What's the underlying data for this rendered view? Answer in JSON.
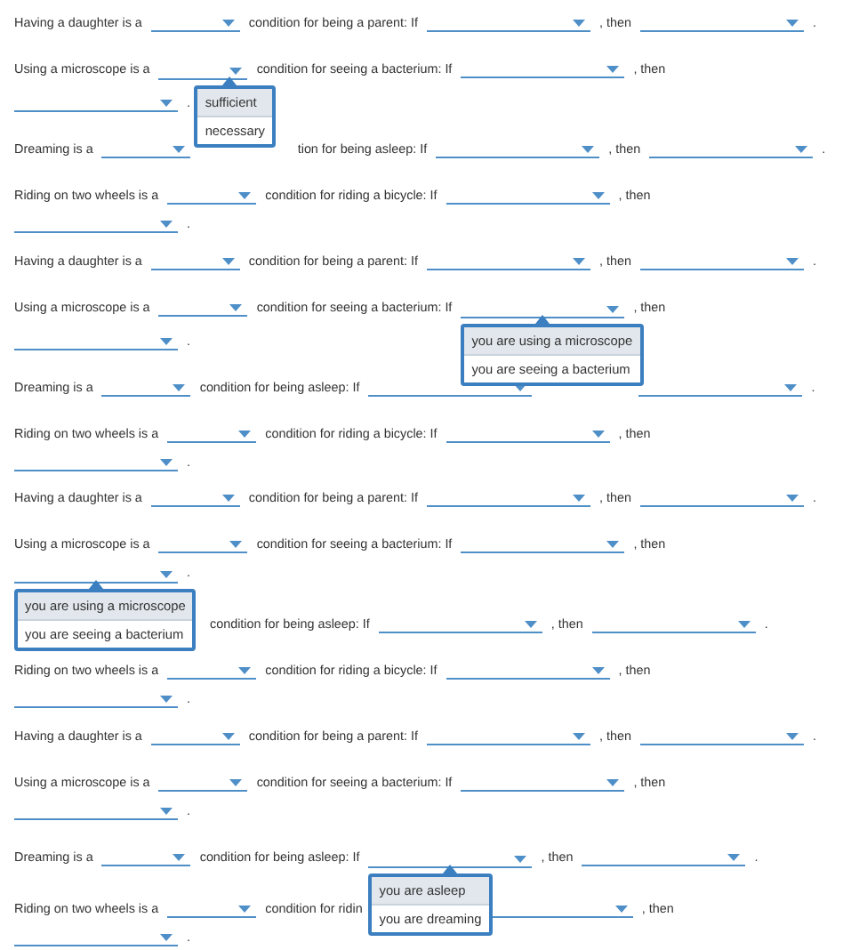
{
  "panels": [
    {
      "questions": [
        {
          "segments": [
            {
              "kind": "text",
              "text": "Having a daughter is a"
            },
            {
              "kind": "choice"
            },
            {
              "kind": "text",
              "text": "condition for being a parent: If"
            },
            {
              "kind": "clause"
            },
            {
              "kind": "text",
              "text": ", then"
            },
            {
              "kind": "clause"
            },
            {
              "kind": "text",
              "text": "."
            }
          ]
        },
        {
          "segments": [
            {
              "kind": "text",
              "text": "Using a microscope is a"
            },
            {
              "kind": "choice",
              "menu": [
                {
                  "label": "sufficient",
                  "selected": true
                },
                {
                  "label": "necessary",
                  "selected": false
                }
              ]
            },
            {
              "kind": "text",
              "text": "condition for seeing a bacterium: If"
            },
            {
              "kind": "clause"
            },
            {
              "kind": "text",
              "text": ", then"
            },
            {
              "kind": "clause"
            },
            {
              "kind": "text",
              "text": "."
            }
          ]
        },
        {
          "segments": [
            {
              "kind": "text",
              "text": "Dreaming is a"
            },
            {
              "kind": "choice"
            },
            {
              "kind": "hidden"
            },
            {
              "kind": "text",
              "text": "tion for being asleep: If"
            },
            {
              "kind": "clause"
            },
            {
              "kind": "text",
              "text": ", then"
            },
            {
              "kind": "clause"
            },
            {
              "kind": "text",
              "text": "."
            }
          ]
        },
        {
          "segments": [
            {
              "kind": "text",
              "text": "Riding on two wheels is a"
            },
            {
              "kind": "choice"
            },
            {
              "kind": "text",
              "text": "condition for riding a bicycle: If"
            },
            {
              "kind": "clause"
            },
            {
              "kind": "text",
              "text": ", then"
            },
            {
              "kind": "clause"
            },
            {
              "kind": "text",
              "text": "."
            }
          ]
        }
      ]
    },
    {
      "questions": [
        {
          "segments": [
            {
              "kind": "text",
              "text": "Having a daughter is a"
            },
            {
              "kind": "choice"
            },
            {
              "kind": "text",
              "text": "condition for being a parent: If"
            },
            {
              "kind": "clause"
            },
            {
              "kind": "text",
              "text": ", then"
            },
            {
              "kind": "clause"
            },
            {
              "kind": "text",
              "text": "."
            }
          ]
        },
        {
          "segments": [
            {
              "kind": "text",
              "text": "Using a microscope is a"
            },
            {
              "kind": "choice"
            },
            {
              "kind": "text",
              "text": "condition for seeing a bacterium: If"
            },
            {
              "kind": "clause",
              "menu": [
                {
                  "label": "you are using a microscope",
                  "selected": true
                },
                {
                  "label": "you are seeing a bacterium",
                  "selected": false
                }
              ]
            },
            {
              "kind": "text",
              "text": ", then"
            },
            {
              "kind": "clause"
            },
            {
              "kind": "text",
              "text": "."
            }
          ]
        },
        {
          "segments": [
            {
              "kind": "text",
              "text": "Dreaming is a"
            },
            {
              "kind": "choice"
            },
            {
              "kind": "text",
              "text": "condition for being asleep: If"
            },
            {
              "kind": "clause"
            },
            {
              "kind": "hidden"
            },
            {
              "kind": "clause"
            },
            {
              "kind": "text",
              "text": "."
            }
          ]
        },
        {
          "segments": [
            {
              "kind": "text",
              "text": "Riding on two wheels is a"
            },
            {
              "kind": "choice"
            },
            {
              "kind": "text",
              "text": "condition for riding a bicycle: If"
            },
            {
              "kind": "clause"
            },
            {
              "kind": "text",
              "text": ", then"
            },
            {
              "kind": "clause"
            },
            {
              "kind": "text",
              "text": "."
            }
          ]
        }
      ]
    },
    {
      "questions": [
        {
          "segments": [
            {
              "kind": "text",
              "text": "Having a daughter is a"
            },
            {
              "kind": "choice"
            },
            {
              "kind": "text",
              "text": "condition for being a parent: If"
            },
            {
              "kind": "clause"
            },
            {
              "kind": "text",
              "text": ", then"
            },
            {
              "kind": "clause"
            },
            {
              "kind": "text",
              "text": "."
            }
          ]
        },
        {
          "segments": [
            {
              "kind": "text",
              "text": "Using a microscope is a"
            },
            {
              "kind": "choice"
            },
            {
              "kind": "text",
              "text": "condition for seeing a bacterium: If"
            },
            {
              "kind": "clause"
            },
            {
              "kind": "text",
              "text": ", then"
            },
            {
              "kind": "clause",
              "menu": [
                {
                  "label": "you are using a microscope",
                  "selected": true
                },
                {
                  "label": "you are seeing a bacterium",
                  "selected": false
                }
              ]
            },
            {
              "kind": "text",
              "text": "."
            }
          ]
        },
        {
          "segments": [
            {
              "kind": "hidden"
            },
            {
              "kind": "hidden"
            },
            {
              "kind": "text",
              "text": "condition for being asleep: If"
            },
            {
              "kind": "clause"
            },
            {
              "kind": "text",
              "text": ", then"
            },
            {
              "kind": "clause"
            },
            {
              "kind": "text",
              "text": "."
            }
          ]
        },
        {
          "segments": [
            {
              "kind": "text",
              "text": "Riding on two wheels is a"
            },
            {
              "kind": "choice"
            },
            {
              "kind": "text",
              "text": "condition for riding a bicycle: If"
            },
            {
              "kind": "clause"
            },
            {
              "kind": "text",
              "text": ", then"
            },
            {
              "kind": "clause"
            },
            {
              "kind": "text",
              "text": "."
            }
          ]
        }
      ]
    },
    {
      "questions": [
        {
          "segments": [
            {
              "kind": "text",
              "text": "Having a daughter is a"
            },
            {
              "kind": "choice"
            },
            {
              "kind": "text",
              "text": "condition for being a parent: If"
            },
            {
              "kind": "clause"
            },
            {
              "kind": "text",
              "text": ", then"
            },
            {
              "kind": "clause"
            },
            {
              "kind": "text",
              "text": "."
            }
          ]
        },
        {
          "segments": [
            {
              "kind": "text",
              "text": "Using a microscope is a"
            },
            {
              "kind": "choice"
            },
            {
              "kind": "text",
              "text": "condition for seeing a bacterium: If"
            },
            {
              "kind": "clause"
            },
            {
              "kind": "text",
              "text": ", then"
            },
            {
              "kind": "clause"
            },
            {
              "kind": "text",
              "text": "."
            }
          ]
        },
        {
          "segments": [
            {
              "kind": "text",
              "text": "Dreaming is a"
            },
            {
              "kind": "choice"
            },
            {
              "kind": "text",
              "text": "condition for being asleep: If"
            },
            {
              "kind": "clause",
              "menu": [
                {
                  "label": "you are asleep",
                  "selected": true
                },
                {
                  "label": "you are dreaming",
                  "selected": false
                }
              ]
            },
            {
              "kind": "text",
              "text": ", then"
            },
            {
              "kind": "clause"
            },
            {
              "kind": "text",
              "text": "."
            }
          ]
        },
        {
          "segments": [
            {
              "kind": "text",
              "text": "Riding on two wheels is a"
            },
            {
              "kind": "choice"
            },
            {
              "kind": "text",
              "text": "condition for ridin"
            },
            {
              "kind": "hidden"
            },
            {
              "kind": "clause"
            },
            {
              "kind": "text",
              "text": ", then"
            },
            {
              "kind": "clause"
            },
            {
              "kind": "text",
              "text": "."
            }
          ]
        }
      ]
    }
  ]
}
